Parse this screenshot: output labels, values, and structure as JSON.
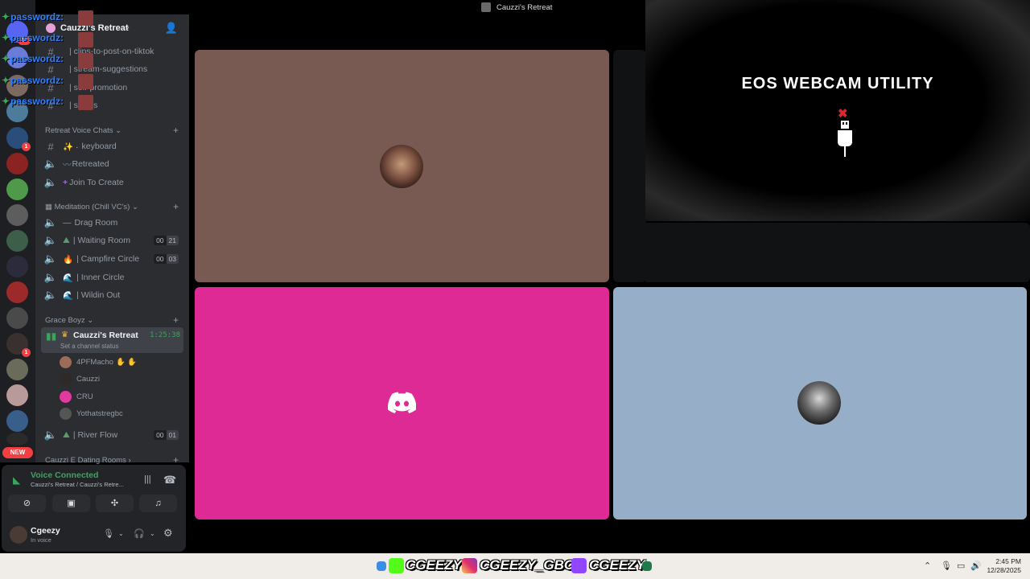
{
  "overlay": {
    "lines": [
      "passwordz:",
      "passwordz:",
      "passwordz:",
      "passwordz:",
      "passwordz:"
    ]
  },
  "rail": {
    "badges": [
      "15",
      "1",
      "1"
    ],
    "new_label": "NEW"
  },
  "server": {
    "name": "Cauzzi's Retreat"
  },
  "channels": {
    "text": [
      {
        "label": "| clips-to-post-on-tiktok"
      },
      {
        "label": "| stream-suggestions"
      },
      {
        "label": "| self-promotion"
      },
      {
        "label": "| selfies"
      }
    ],
    "cat_retreat": "Retreat Voice Chats",
    "retreat": [
      {
        "label": "keyboard",
        "emoji": "✨ ·"
      },
      {
        "label": "Retreated",
        "emoji": ""
      },
      {
        "label": "Join To Create",
        "emoji": ""
      }
    ],
    "cat_meditation": "Meditation (Chill VC's)",
    "meditation": [
      {
        "label": "Drag Room",
        "emoji": ""
      },
      {
        "label": "| Waiting Room",
        "count_a": "00",
        "count_b": "21"
      },
      {
        "label": "| Campfire Circle",
        "count_a": "00",
        "count_b": "03"
      },
      {
        "label": "| Inner Circle"
      },
      {
        "label": "| Wildin Out"
      }
    ],
    "cat_grace": "Grace Boyz",
    "active": {
      "name": "Cauzzi's Retreat",
      "status": "Set a channel status",
      "time": "1:25:38"
    },
    "voice_users": [
      "4PFMacho",
      "Cauzzi",
      "CRU",
      "Yothatstregbc"
    ],
    "river": {
      "label": "| River Flow",
      "count_a": "00",
      "count_b": "01"
    },
    "cat_dating": "Cauzzi E Dating Rooms"
  },
  "voice_panel": {
    "status": "Voice Connected",
    "location": "Cauzzi's Retreat / Cauzzi's Retre..."
  },
  "user": {
    "name": "Cgeezy",
    "status": "In voice"
  },
  "titlebar": {
    "title": "Cauzzi's Retreat"
  },
  "eos": {
    "title": "EOS WEBCAM UTILITY"
  },
  "taskbar": {
    "brand1": "CGEEZY",
    "brand2": "CGEEZY_GBC",
    "brand3": "CGEEZY",
    "time": "2:45 PM",
    "date": "12/28/2025"
  },
  "colors": {
    "tile_brown": "#785a53",
    "tile_pink": "#dd2a95",
    "tile_blue": "#96aec8",
    "accent_green": "#3ba55d",
    "discord_blurple": "#5865f2"
  }
}
